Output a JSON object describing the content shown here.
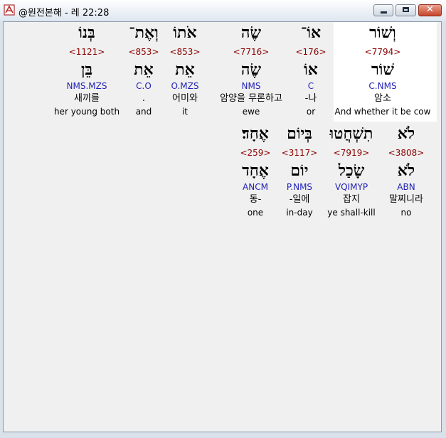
{
  "window": {
    "title": "@원전본해 - 레 22:28",
    "minimize_icon": "minimize-icon",
    "maximize_icon": "maximize-icon",
    "close_icon": "close-icon",
    "close_glyph": "✕"
  },
  "rows": [
    {
      "words": [
        {
          "heb": "וְשׁוֹר",
          "strong": "<7794>",
          "lemma": "שׁוֹר",
          "parse": "C.NMS",
          "kor": "암소",
          "eng": "And whether it be cow",
          "highlight": true
        },
        {
          "heb": "אוֹ־",
          "strong": "<176>",
          "lemma": "אוֹ",
          "parse": "C",
          "kor": "-나",
          "eng": "or"
        },
        {
          "heb": "שֶׂה",
          "strong": "<7716>",
          "lemma": "שֶׂה",
          "parse": "NMS",
          "kor": "암양을 무론하고",
          "eng": "ewe"
        },
        {
          "heb": "אֹתוֹ",
          "strong": "<853>",
          "lemma": "אֵת",
          "parse": "O.MZS",
          "kor": "어미와",
          "eng": "it"
        },
        {
          "heb": "וְאֶת־",
          "strong": "<853>",
          "lemma": "אֵת",
          "parse": "C.O",
          "kor": ".",
          "eng": "and"
        },
        {
          "heb": "בְּנוֹ",
          "strong": "<1121>",
          "lemma": "בֵּן",
          "parse": "NMS.MZS",
          "kor": "새끼를",
          "eng": "her young both"
        }
      ]
    },
    {
      "words": [
        {
          "heb": "לֹא",
          "strong": "<3808>",
          "lemma": "לֹא",
          "parse": "ABN",
          "kor": "말찌니라",
          "eng": "no"
        },
        {
          "heb": "תִשְׁחֲטוּ",
          "strong": "<7919>",
          "lemma": "שָׂכַל",
          "parse": "VQIMYP",
          "kor": "잡지",
          "eng": "ye shall-kill"
        },
        {
          "heb": "בְּיוֹם",
          "strong": "<3117>",
          "lemma": "יוֹם",
          "parse": "P.NMS",
          "kor": "-일에",
          "eng": "in-day"
        },
        {
          "heb": "אֶחָד׃",
          "strong": "<259>",
          "lemma": "אֶחָד",
          "parse": "ANCM",
          "kor": "동-",
          "eng": "one"
        }
      ]
    }
  ]
}
